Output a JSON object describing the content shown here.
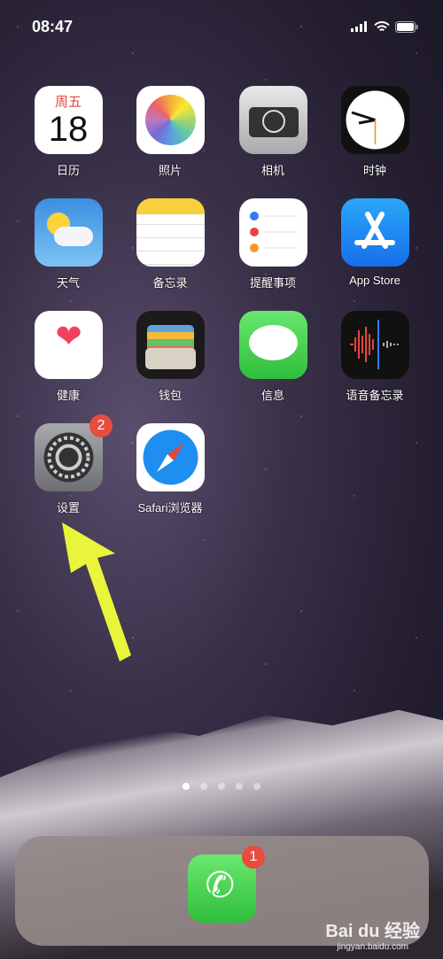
{
  "status_bar": {
    "time": "08:47",
    "icons": [
      "signal-icon",
      "wifi-icon",
      "battery-icon"
    ]
  },
  "apps": [
    {
      "label": "日历",
      "icon": "calendar-icon",
      "weekday": "周五",
      "day": "18"
    },
    {
      "label": "照片",
      "icon": "photos-icon"
    },
    {
      "label": "相机",
      "icon": "camera-icon"
    },
    {
      "label": "时钟",
      "icon": "clock-icon"
    },
    {
      "label": "天气",
      "icon": "weather-icon"
    },
    {
      "label": "备忘录",
      "icon": "notes-icon"
    },
    {
      "label": "提醒事项",
      "icon": "reminders-icon"
    },
    {
      "label": "App Store",
      "icon": "app-store-icon"
    },
    {
      "label": "健康",
      "icon": "health-icon"
    },
    {
      "label": "钱包",
      "icon": "wallet-icon"
    },
    {
      "label": "信息",
      "icon": "messages-icon"
    },
    {
      "label": "语音备忘录",
      "icon": "voice-memos-icon"
    },
    {
      "label": "设置",
      "icon": "settings-icon",
      "badge": "2"
    },
    {
      "label": "Safari浏览器",
      "icon": "safari-icon"
    }
  ],
  "page_indicator": {
    "count": 5,
    "current": 1
  },
  "dock": {
    "apps": [
      {
        "icon": "phone-icon",
        "badge": "1"
      }
    ]
  },
  "annotation": {
    "arrow_color": "#e8f53a"
  },
  "watermark": {
    "brand": "Bai du 经验",
    "url": "jingyan.baidu.com"
  }
}
